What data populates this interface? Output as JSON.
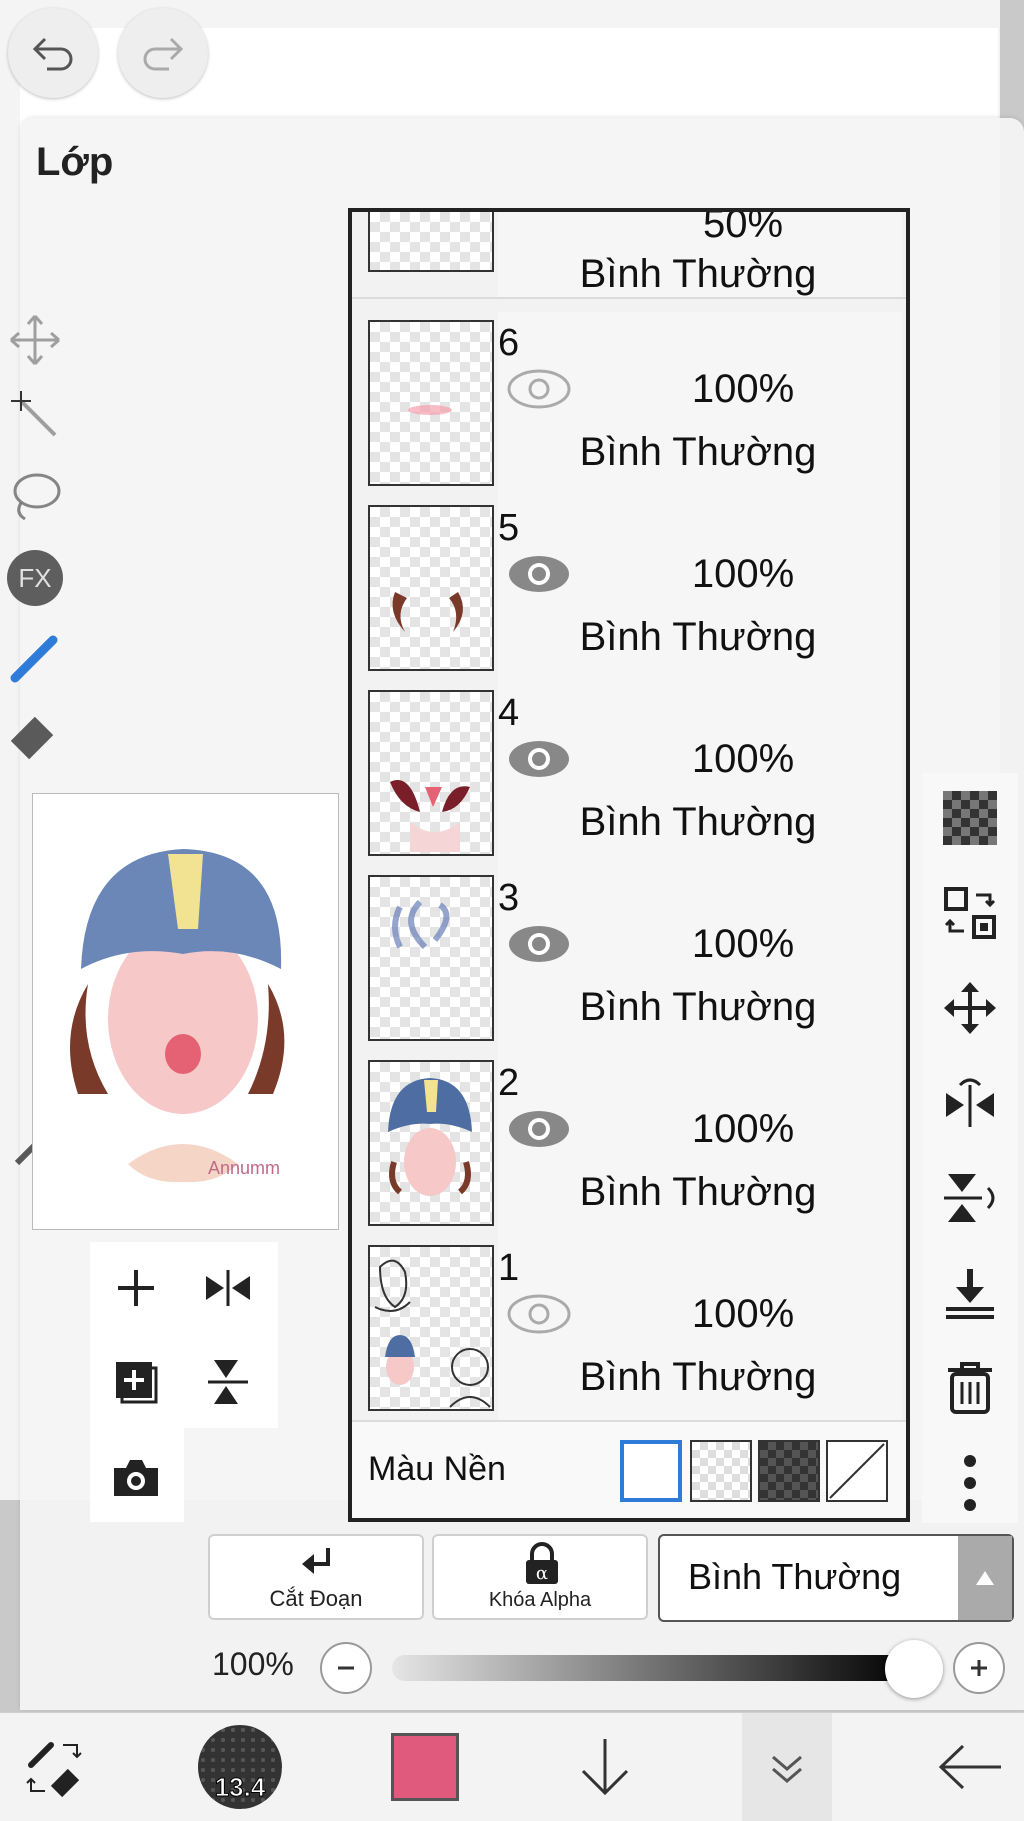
{
  "panel": {
    "title": "Lớp"
  },
  "layers": [
    {
      "num": "",
      "opacity": "50%",
      "blend": "Bình Thường",
      "visible": true
    },
    {
      "num": "6",
      "opacity": "100%",
      "blend": "Bình Thường",
      "visible": true
    },
    {
      "num": "5",
      "opacity": "100%",
      "blend": "Bình Thường",
      "visible": true
    },
    {
      "num": "4",
      "opacity": "100%",
      "blend": "Bình Thường",
      "visible": true
    },
    {
      "num": "3",
      "opacity": "100%",
      "blend": "Bình Thường",
      "visible": true
    },
    {
      "num": "2",
      "opacity": "100%",
      "blend": "Bình Thường",
      "visible": true
    },
    {
      "num": "1",
      "opacity": "100%",
      "blend": "Bình Thường",
      "visible": true
    }
  ],
  "background": {
    "label": "Màu Nền",
    "selected": "white"
  },
  "options": {
    "clipping_label": "Cắt Đoạn",
    "alpha_lock_label": "Khóa Alpha",
    "blend_mode": "Bình Thường"
  },
  "opacity": {
    "label": "100%",
    "value": 1.0
  },
  "toolbar": {
    "brush_size": "13.4",
    "color": "#e05a7e"
  },
  "colors": {
    "accent_blue": "#2f7bd8",
    "eye_active": "#888888",
    "eye_inactive": "#aaaaaa"
  },
  "preview": {
    "signature": "Annumm"
  }
}
